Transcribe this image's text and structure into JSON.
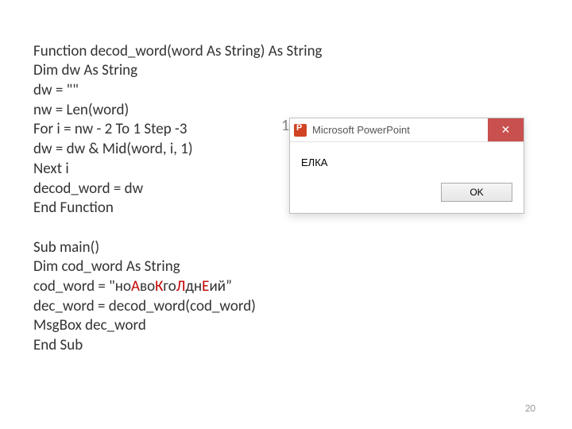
{
  "code": {
    "l1": "Function decod_word(word As String) As String",
    "l2": "Dim dw As String",
    "l3": "dw = \"\"",
    "l4": "nw = Len(word)",
    "l5": "For i = nw - 2 To 1 Step -3",
    "l6": "dw = dw & Mid(word, i, 1)",
    "l7": "Next i",
    "l8": "decod_word = dw",
    "l9": "End Function",
    "l10": "",
    "l11": "Sub main()",
    "l12": "Dim cod_word As String",
    "l13_pre": "cod_word = \"но",
    "l13_a": "А",
    "l13_mid1": "во",
    "l13_k": "К",
    "l13_mid2": "го",
    "l13_l": "Л",
    "l13_mid3": "дн",
    "l13_e": "Е",
    "l13_post": "ий”",
    "l14": "dec_word = decod_word(cod_word)",
    "l15": "MsgBox dec_word",
    "l16": "End Sub"
  },
  "dialog": {
    "title": "Microsoft PowerPoint",
    "message": "ЕЛКА",
    "ok": "OK",
    "close_glyph": "✕"
  },
  "page_number": "20",
  "behind_number": "1"
}
